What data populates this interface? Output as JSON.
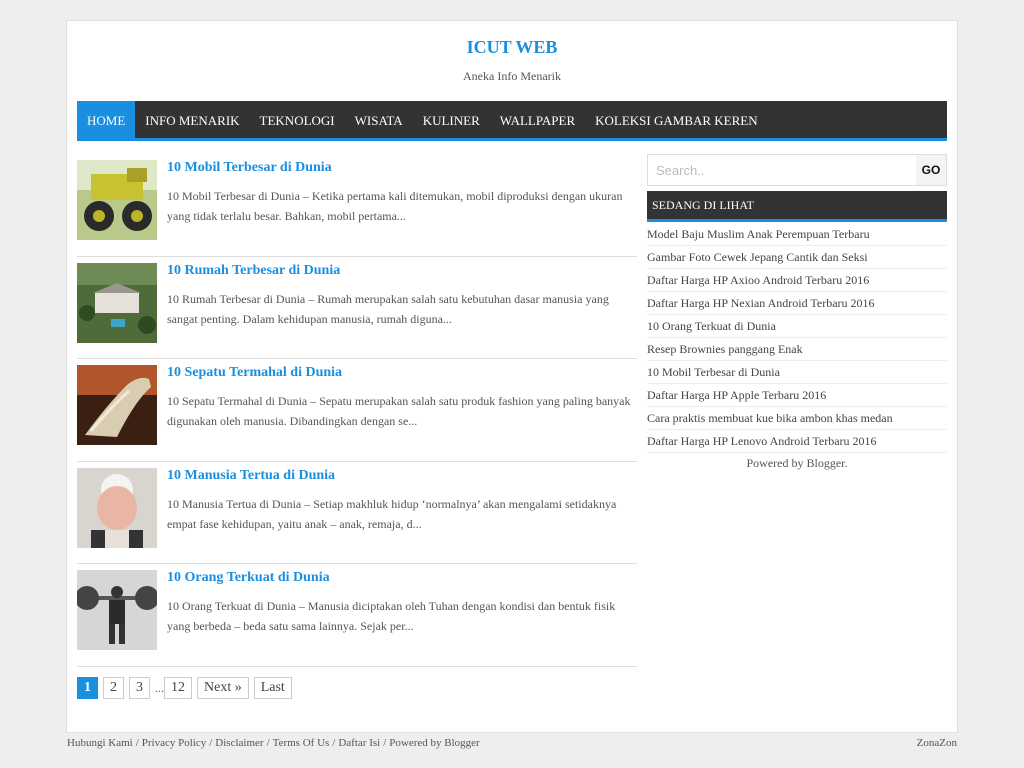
{
  "header": {
    "title": "ICUT WEB",
    "description": "Aneka Info Menarik"
  },
  "nav": {
    "items": [
      {
        "label": "HOME",
        "active": true
      },
      {
        "label": "INFO MENARIK"
      },
      {
        "label": "TEKNOLOGI"
      },
      {
        "label": "WISATA"
      },
      {
        "label": "KULINER"
      },
      {
        "label": "WALLPAPER"
      },
      {
        "label": "KOLEKSI GAMBAR KEREN"
      }
    ]
  },
  "posts": [
    {
      "title": "10 Mobil Terbesar di Dunia",
      "excerpt": "10 Mobil Terbesar di Dunia – Ketika pertama kali ditemukan, mobil diproduksi dengan ukuran yang tidak terlalu besar. Bahkan, mobil pertama..."
    },
    {
      "title": "10 Rumah Terbesar di Dunia",
      "excerpt": "10 Rumah Terbesar di Dunia – Rumah merupakan salah satu kebutuhan dasar manusia yang sangat penting. Dalam kehidupan manusia, rumah diguna..."
    },
    {
      "title": "10 Sepatu Termahal di Dunia",
      "excerpt": "10 Sepatu Termahal di Dunia – Sepatu merupakan salah satu produk fashion yang paling banyak digunakan oleh manusia. Dibandingkan dengan se..."
    },
    {
      "title": "10 Manusia Tertua di Dunia",
      "excerpt": "10 Manusia Tertua di Dunia – Setiap makhluk hidup ‘normalnya’ akan mengalami setidaknya empat fase kehidupan, yaitu anak – anak, remaja, d..."
    },
    {
      "title": "10 Orang Terkuat di Dunia",
      "excerpt": "10 Orang Terkuat di Dunia – Manusia diciptakan oleh Tuhan dengan kondisi dan bentuk fisik yang berbeda – beda satu sama lainnya. Sejak per..."
    }
  ],
  "pagination": {
    "current": "1",
    "pages": [
      "2",
      "3"
    ],
    "dots": "...",
    "last_page": "12",
    "next": "Next »",
    "last": "Last"
  },
  "sidebar": {
    "search_placeholder": "Search..",
    "search_button": "GO",
    "widget_title": "SEDANG DI LIHAT",
    "popular": [
      "Model Baju Muslim Anak Perempuan Terbaru",
      "Gambar Foto Cewek Jepang Cantik dan Seksi",
      "Daftar Harga HP Axioo Android Terbaru 2016",
      "Daftar Harga HP Nexian Android Terbaru 2016",
      "10 Orang Terkuat di Dunia",
      "Resep Brownies panggang Enak",
      "10 Mobil Terbesar di Dunia",
      "Daftar Harga HP Apple Terbaru 2016",
      "Cara praktis membuat kue bika ambon khas medan",
      "Daftar Harga HP Lenovo Android Terbaru 2016"
    ],
    "powered": "Powered by Blogger."
  },
  "footer": {
    "links": [
      "Hubungi Kami",
      "Privacy Policy",
      "Disclaimer",
      "Terms Of Us",
      "Daftar Isi",
      "Powered by Blogger"
    ],
    "separator": "/",
    "right": "ZonaZon"
  },
  "colors": {
    "accent": "#1a8fdf",
    "nav_bg": "#333333",
    "page_bg": "#eeeeee"
  }
}
